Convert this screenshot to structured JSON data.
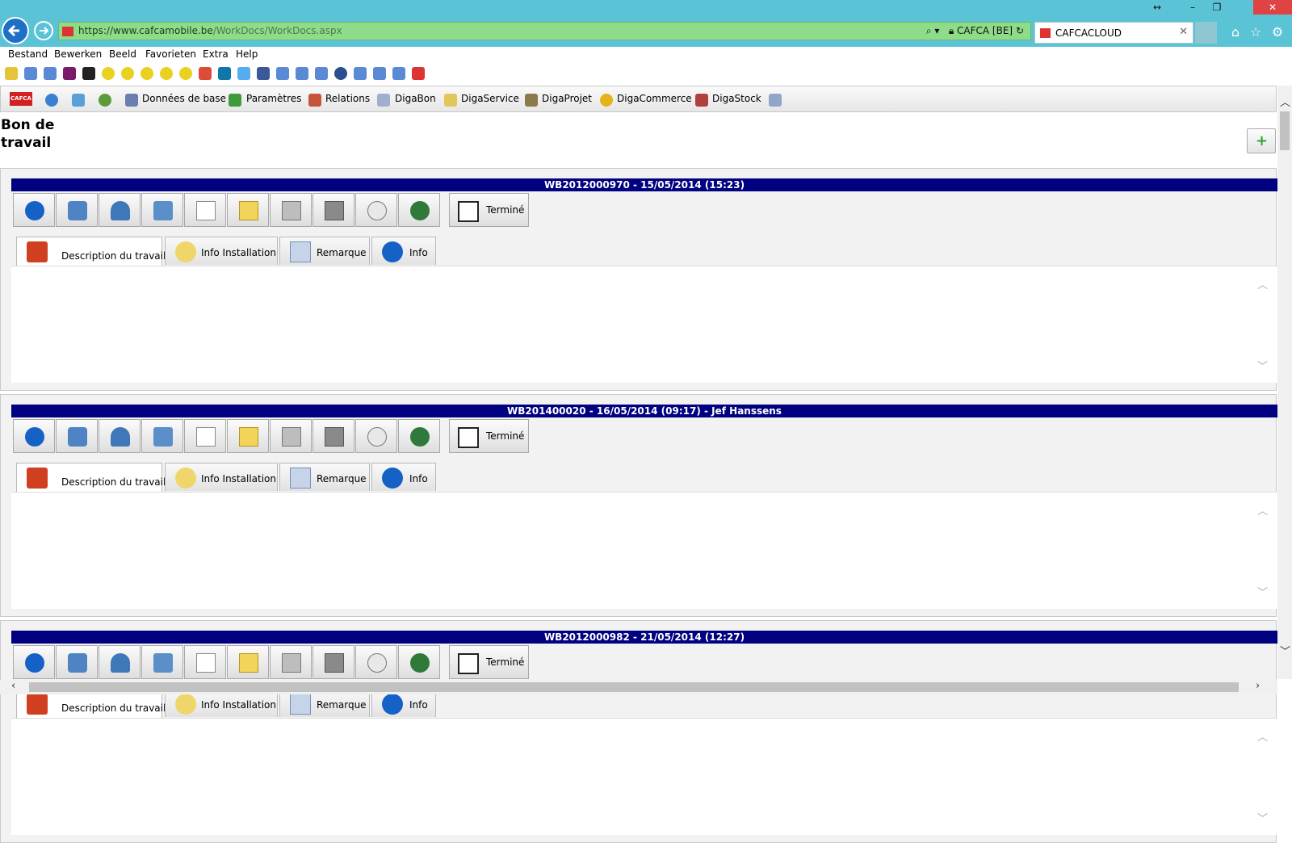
{
  "browser": {
    "url_base": "https://www.cafcamobile.be",
    "url_path": "/WorkDocs/WorkDocs.aspx",
    "site_identity": "CAFCA [BE]",
    "tab_title": "CAFCACLOUD"
  },
  "menubar": [
    "Bestand",
    "Bewerken",
    "Beeld",
    "Favorieten",
    "Extra",
    "Help"
  ],
  "app_toolbar": {
    "logo_text": "CAFCA",
    "items": [
      "Données de base",
      "Paramètres",
      "Relations",
      "DigaBon",
      "DigaService",
      "DigaProjet",
      "DigaCommerce",
      "DigaStock"
    ]
  },
  "page": {
    "title": "Bon de travail",
    "add_label": "+"
  },
  "cards": [
    {
      "header": "WB2012000970 - 15/05/2014 (15:23)"
    },
    {
      "header": "WB201400020 - 16/05/2014 (09:17) - Jef Hanssens"
    },
    {
      "header": "WB2012000982 - 21/05/2014 (12:27)"
    }
  ],
  "card_labels": {
    "termine": "Terminé",
    "tabs": [
      "Description du travail",
      "Info Installation",
      "Remarque",
      "Info"
    ]
  },
  "icons": {
    "toolbar_buttons": [
      "alert-icon",
      "car-icon",
      "person-icon",
      "plug-bulb-icon",
      "document-icon",
      "folder-icon",
      "printer-icon",
      "copy-icon",
      "clock-list-icon",
      "globe-icon"
    ]
  },
  "colors": {
    "card_header_bg": "#000080",
    "chrome_bg": "#5bc3d6",
    "address_bg": "#8edc8a"
  }
}
